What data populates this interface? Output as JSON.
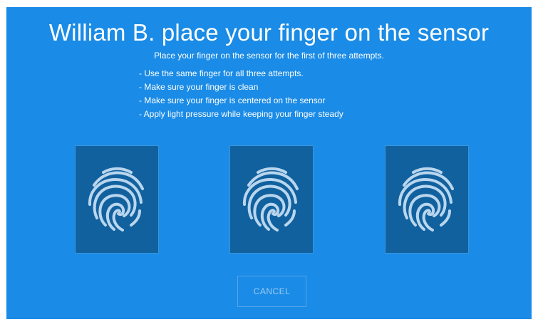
{
  "prompt": {
    "title": "William B. place your finger on the sensor",
    "subtitle": "Place your finger on the sensor for the first of three attempts."
  },
  "instructions": [
    "- Use the same finger for all three attempts.",
    "- Make sure your finger is clean",
    "- Make sure your finger is centered on the sensor",
    "- Apply light pressure while keeping your finger steady"
  ],
  "attempts": [
    {
      "icon": "fingerprint-icon"
    },
    {
      "icon": "fingerprint-icon"
    },
    {
      "icon": "fingerprint-icon"
    }
  ],
  "actions": {
    "cancel_label": "CANCEL"
  },
  "colors": {
    "background": "#1a8be6",
    "card": "#11619f",
    "fingerprint": "#b9d6ee",
    "cancel_text": "#9ccbf1"
  }
}
